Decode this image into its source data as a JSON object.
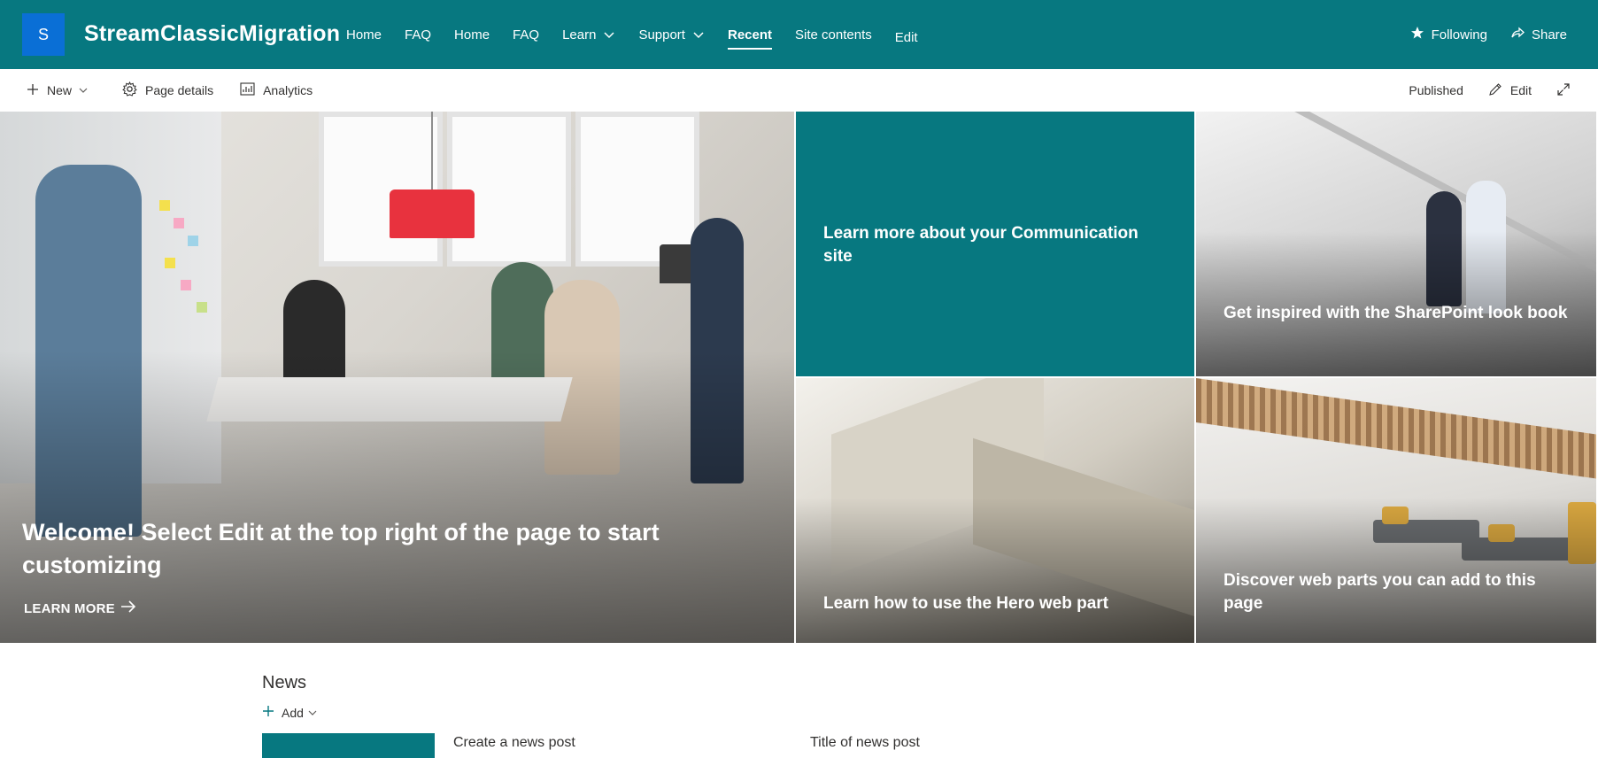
{
  "header": {
    "logo_letter": "S",
    "site_title": "StreamClassicMigration",
    "nav": [
      {
        "label": "Home"
      },
      {
        "label": "FAQ"
      },
      {
        "label": "Home"
      },
      {
        "label": "FAQ"
      },
      {
        "label": "Learn"
      },
      {
        "label": "Support"
      },
      {
        "label": "Recent"
      },
      {
        "label": "Site contents"
      },
      {
        "label": "Edit"
      }
    ],
    "following_label": "Following",
    "share_label": "Share"
  },
  "commandbar": {
    "new_label": "New",
    "page_details_label": "Page details",
    "analytics_label": "Analytics",
    "status": "Published",
    "edit_label": "Edit"
  },
  "hero": {
    "main_caption": "Welcome! Select Edit at the top right of the page to start customizing",
    "learn_more": "LEARN MORE",
    "tile_teal": "Learn more about your Communication site",
    "tile_lookbook": "Get inspired with the SharePoint look book",
    "tile_heroweb": "Learn how to use the Hero web part",
    "tile_discover": "Discover web parts you can add to this page"
  },
  "news": {
    "title": "News",
    "add_label": "Add",
    "create_post": "Create a news post",
    "post_title": "Title of news post"
  },
  "colors": {
    "theme": "#077880",
    "logo": "#0a6fd6"
  }
}
